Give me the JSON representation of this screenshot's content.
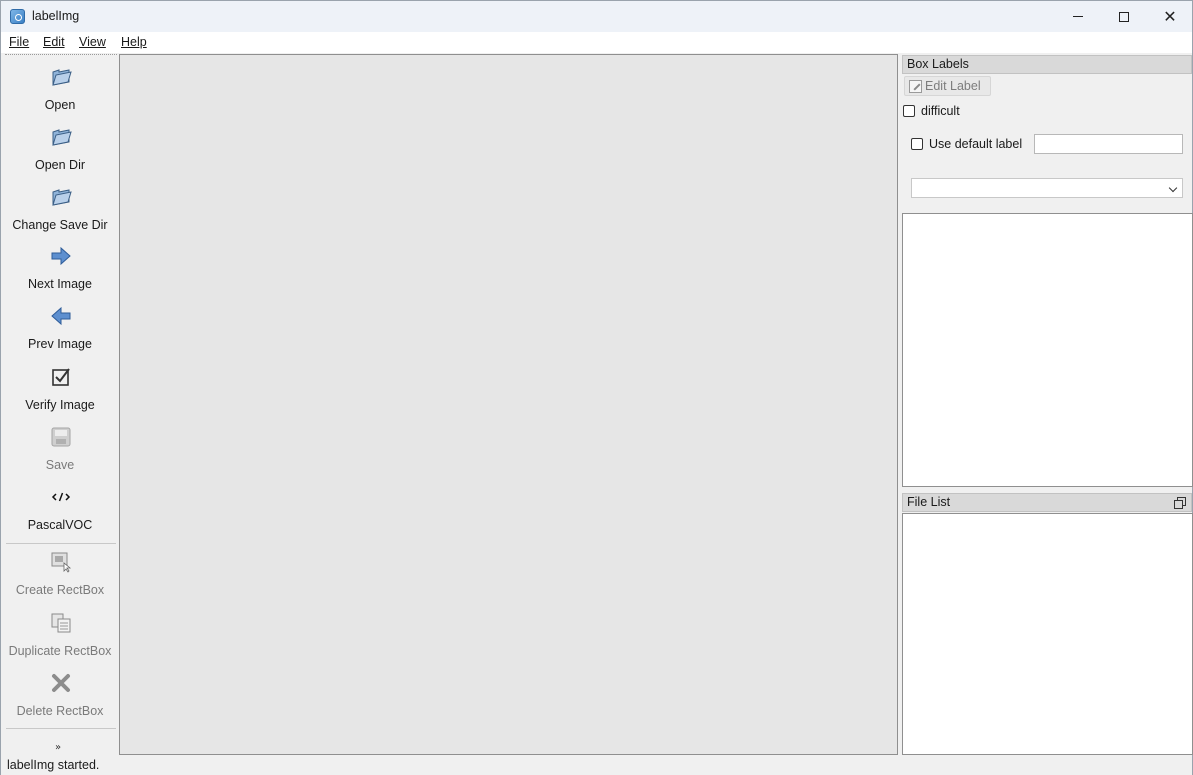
{
  "window": {
    "title": "labelImg"
  },
  "menu": {
    "items": [
      {
        "label": "File"
      },
      {
        "label": "Edit"
      },
      {
        "label": "View"
      },
      {
        "label": "Help"
      }
    ]
  },
  "toolbar": {
    "tools": [
      {
        "label": "Open",
        "icon": "folder-open-icon",
        "enabled": true
      },
      {
        "label": "Open Dir",
        "icon": "folder-open-icon",
        "enabled": true
      },
      {
        "label": "Change Save Dir",
        "icon": "folder-open-icon",
        "enabled": true
      },
      {
        "label": "Next Image",
        "icon": "arrow-right-icon",
        "enabled": true
      },
      {
        "label": "Prev Image",
        "icon": "arrow-left-icon",
        "enabled": true
      },
      {
        "label": "Verify Image",
        "icon": "checkbox-checked-icon",
        "enabled": true
      },
      {
        "label": "Save",
        "icon": "save-icon",
        "enabled": false
      },
      {
        "label": "PascalVOC",
        "icon": "code-icon",
        "enabled": true
      },
      {
        "label": "Create RectBox",
        "icon": "create-rectbox-icon",
        "enabled": false
      },
      {
        "label": "Duplicate RectBox",
        "icon": "duplicate-icon",
        "enabled": false
      },
      {
        "label": "Delete RectBox",
        "icon": "delete-icon",
        "enabled": false
      }
    ]
  },
  "box_labels": {
    "title": "Box Labels",
    "edit_label": "Edit Label",
    "difficult_label": "difficult",
    "difficult_checked": false,
    "use_default_label": "Use default label",
    "use_default_checked": false,
    "default_label_value": "",
    "combo_value": ""
  },
  "file_list": {
    "title": "File List"
  },
  "status": {
    "text": "labelImg started."
  }
}
